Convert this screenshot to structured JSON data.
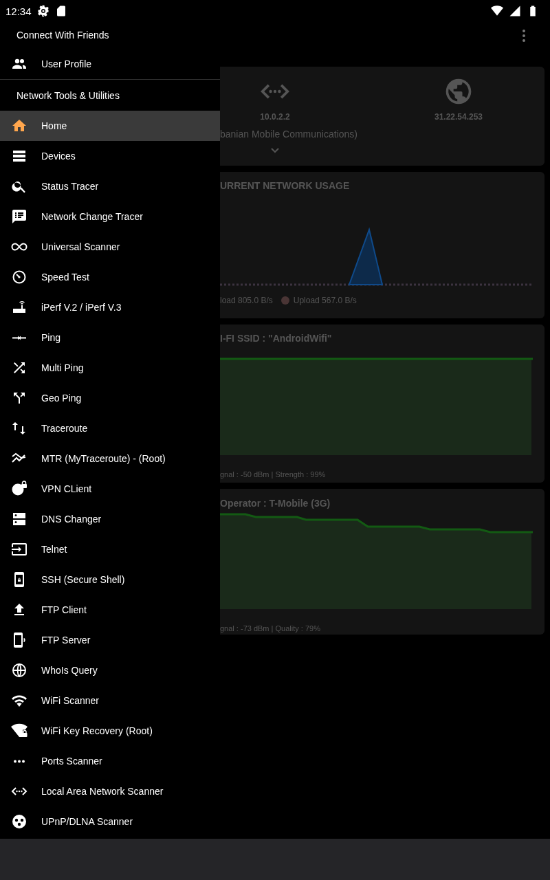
{
  "status_bar": {
    "time": "12:34"
  },
  "drawer": {
    "sections": [
      {
        "header": "Connect With Friends",
        "items": [
          {
            "label": "User Profile",
            "selected": false
          }
        ]
      },
      {
        "header": "Network Tools & Utilities",
        "items": [
          {
            "label": "Home",
            "selected": true
          },
          {
            "label": "Devices",
            "selected": false
          },
          {
            "label": "Status Tracer",
            "selected": false
          },
          {
            "label": "Network Change Tracer",
            "selected": false
          },
          {
            "label": "Universal Scanner",
            "selected": false
          },
          {
            "label": "Speed Test",
            "selected": false
          },
          {
            "label": "iPerf V.2 / iPerf V.3",
            "selected": false
          },
          {
            "label": "Ping",
            "selected": false
          },
          {
            "label": "Multi Ping",
            "selected": false
          },
          {
            "label": "Geo Ping",
            "selected": false
          },
          {
            "label": "Traceroute",
            "selected": false
          },
          {
            "label": "MTR (MyTraceroute) - (Root)",
            "selected": false
          },
          {
            "label": "VPN CLient",
            "selected": false
          },
          {
            "label": "DNS Changer",
            "selected": false
          },
          {
            "label": "Telnet",
            "selected": false
          },
          {
            "label": "SSH (Secure Shell)",
            "selected": false
          },
          {
            "label": "FTP Client",
            "selected": false
          },
          {
            "label": "FTP Server",
            "selected": false
          },
          {
            "label": "WhoIs Query",
            "selected": false
          },
          {
            "label": "WiFi Scanner",
            "selected": false
          },
          {
            "label": "WiFi Key Recovery (Root)",
            "selected": false
          },
          {
            "label": "Ports Scanner",
            "selected": false
          },
          {
            "label": "Local Area Network Scanner",
            "selected": false
          },
          {
            "label": "UPnP/DLNA Scanner",
            "selected": false
          }
        ]
      }
    ]
  },
  "main": {
    "connection_card": {
      "local_ip": "10.0.2.2",
      "public_ip": "31.22.54.253",
      "operator_text": "banian Mobile Communications)"
    },
    "usage_card": {
      "title": "URRENT NETWORK USAGE",
      "legend": [
        {
          "label": "load 805.0  B/s"
        },
        {
          "label": "Upload 567.0  B/s",
          "color": "#4a3535"
        }
      ]
    },
    "wifi_card": {
      "title": "I-FI SSID :  \"AndroidWifi\"",
      "footer": "gnal : -50 dBm  |  Strength : 99%"
    },
    "cellular_card": {
      "title": "Operator : T-Mobile (3G)",
      "footer": "gnal :  -73 dBm  |  Quality : 79%"
    }
  }
}
